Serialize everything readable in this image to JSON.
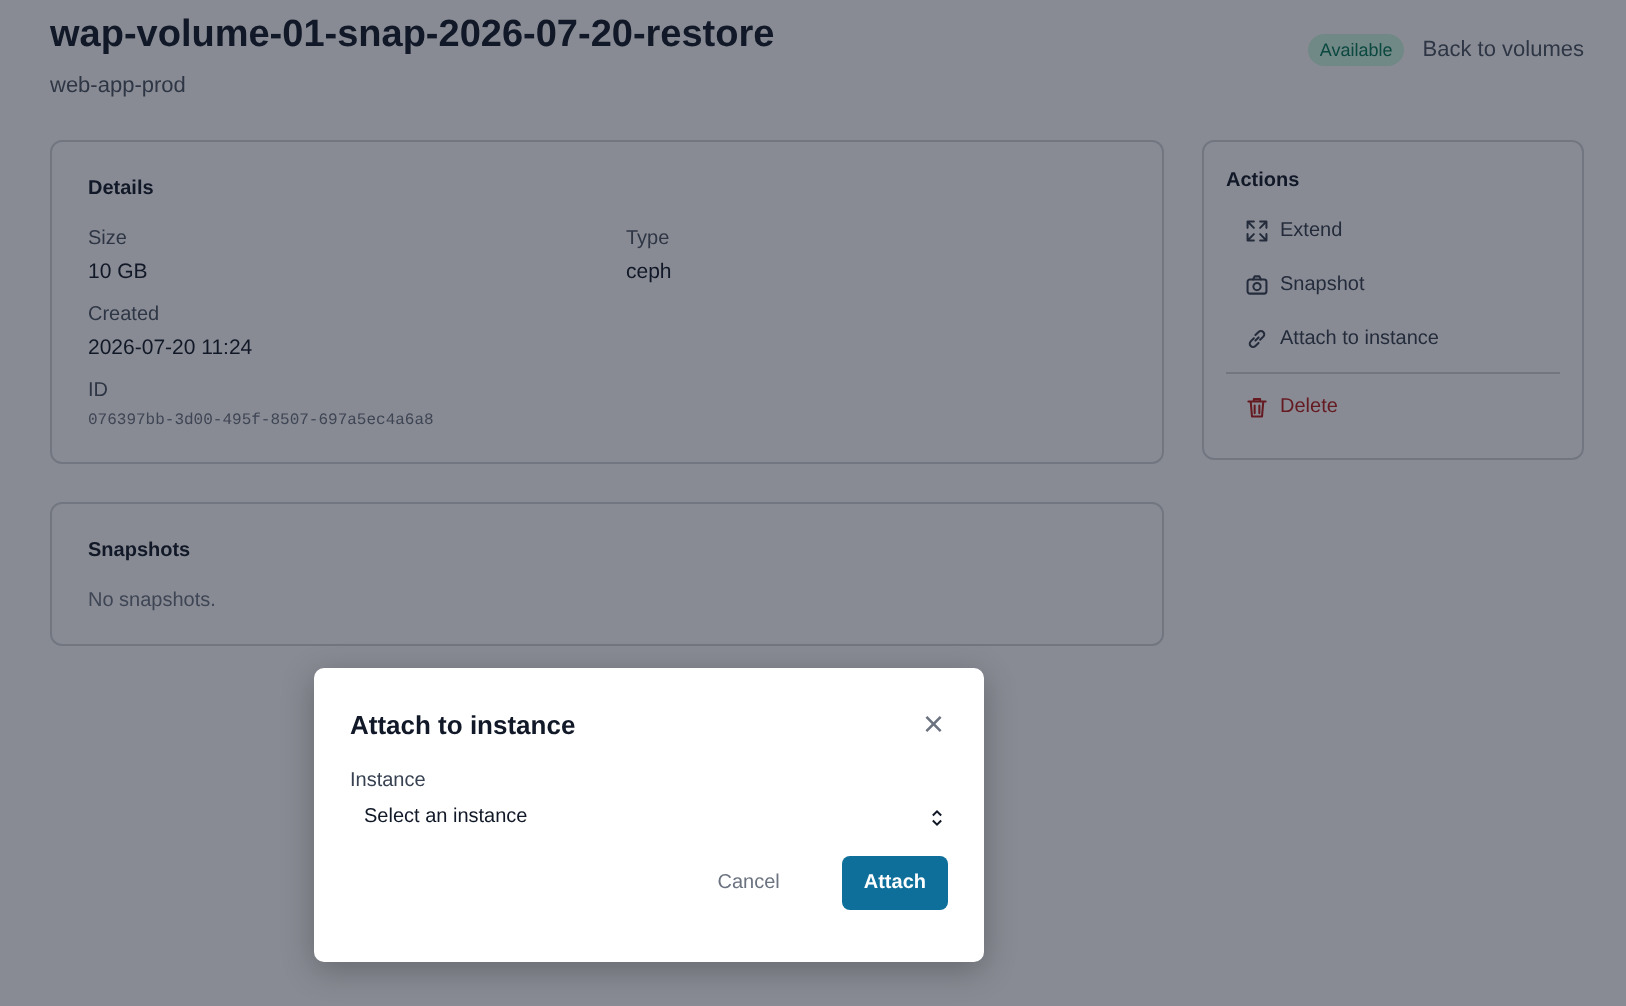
{
  "header": {
    "title": "wap-volume-01-snap-2026-07-20-restore",
    "subtitle": "web-app-prod",
    "status": {
      "label": "Available",
      "kind": "success"
    },
    "back_link": "Back to volumes"
  },
  "details": {
    "title": "Details",
    "fields": [
      {
        "label": "Size",
        "value": "10 GB",
        "kind": "text"
      },
      {
        "label": "Type",
        "value": "ceph",
        "kind": "text"
      },
      {
        "label": "Created",
        "value": "2026-07-20 11:24",
        "kind": "text"
      },
      {
        "label": "ID",
        "value": "076397bb-3d00-495f-8507-697a5ec4a6a8",
        "kind": "mono"
      }
    ]
  },
  "snapshots": {
    "title": "Snapshots",
    "empty_text": "No snapshots."
  },
  "actions": {
    "title": "Actions",
    "items": [
      {
        "label": "Extend",
        "kind": "normal"
      },
      {
        "label": "Snapshot",
        "kind": "normal"
      },
      {
        "label": "Attach to instance",
        "kind": "normal"
      },
      {
        "label": "Delete",
        "kind": "danger"
      }
    ]
  },
  "dialog": {
    "title": "Attach to instance",
    "close": "×",
    "field": {
      "label": "Instance",
      "placeholder": "Select an instance"
    },
    "buttons": [
      {
        "label": "Cancel",
        "kind": "secondary"
      },
      {
        "label": "Attach",
        "kind": "primary"
      }
    ]
  }
}
